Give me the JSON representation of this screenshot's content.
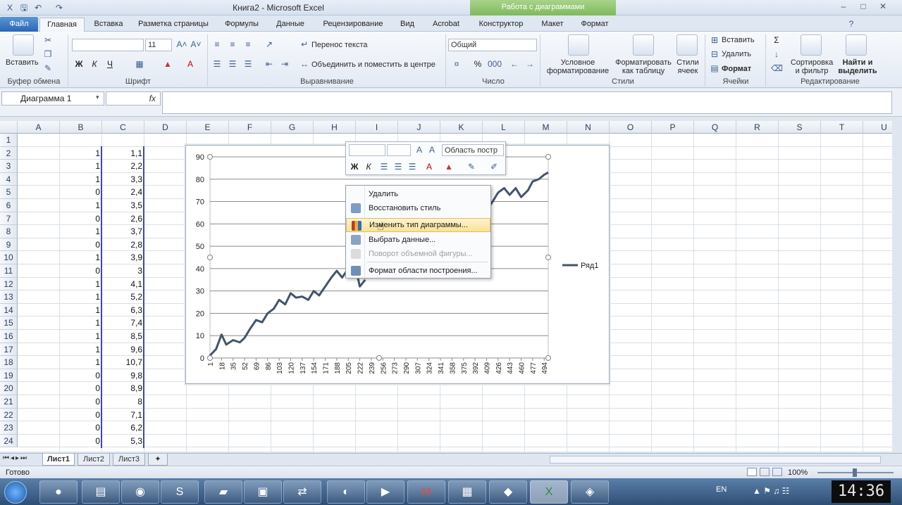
{
  "window": {
    "title": "Книга2 - Microsoft Excel",
    "chart_tools": "Работа с диаграммами"
  },
  "tabs": [
    "Файл",
    "Главная",
    "Вставка",
    "Разметка страницы",
    "Формулы",
    "Данные",
    "Рецензирование",
    "Вид",
    "Acrobat",
    "Конструктор",
    "Макет",
    "Формат"
  ],
  "ribbon": {
    "clipboard": {
      "paste": "Вставить",
      "label": "Буфер обмена"
    },
    "font": {
      "size": "11",
      "label": "Шрифт",
      "bold": "Ж",
      "italic": "К",
      "underline": "Ч"
    },
    "alignment": {
      "wrap": "Перенос текста",
      "merge": "Объединить и поместить в центре",
      "label": "Выравнивание"
    },
    "number": {
      "format": "Общий",
      "percent": "%",
      "label": "Число"
    },
    "styles": {
      "conditional": "Условное форматирование",
      "as_table": "Форматировать как таблицу",
      "cell_styles": "Стили ячеек",
      "label": "Стили"
    },
    "cells": {
      "insert": "Вставить",
      "delete": "Удалить",
      "format": "Формат",
      "label": "Ячейки"
    },
    "editing": {
      "sum": "Σ",
      "sort": "Сортировка и фильтр",
      "find": "Найти и выделить",
      "label": "Редактирование"
    }
  },
  "formula_bar": {
    "name_box": "Диаграмма 1",
    "fx": "fx"
  },
  "columns": [
    "A",
    "B",
    "C",
    "D",
    "E",
    "F",
    "G",
    "H",
    "I",
    "J",
    "K",
    "L",
    "M",
    "N",
    "O",
    "P",
    "Q",
    "R",
    "S",
    "T",
    "U"
  ],
  "rows": [
    "1",
    "2",
    "3",
    "4",
    "5",
    "6",
    "7",
    "8",
    "9",
    "10",
    "11",
    "12",
    "13",
    "14",
    "15",
    "16",
    "17",
    "18",
    "19",
    "20",
    "21",
    "22",
    "23",
    "24"
  ],
  "col_b": [
    "",
    "1",
    "1",
    "1",
    "0",
    "1",
    "0",
    "1",
    "0",
    "1",
    "0",
    "1",
    "1",
    "1",
    "1",
    "1",
    "1",
    "1",
    "0",
    "0",
    "0",
    "0",
    "0",
    "0"
  ],
  "col_c": [
    "",
    "1,1",
    "2,2",
    "3,3",
    "2,4",
    "3,5",
    "2,6",
    "3,7",
    "2,8",
    "3,9",
    "3",
    "4,1",
    "5,2",
    "6,3",
    "7,4",
    "8,5",
    "9,6",
    "10,7",
    "9,8",
    "8,9",
    "8",
    "7,1",
    "6,2",
    "5,3"
  ],
  "mini_toolbar": {
    "element": "Область постр",
    "bold": "Ж",
    "italic": "К"
  },
  "context_menu": {
    "items": [
      {
        "label": "Удалить",
        "enabled": true
      },
      {
        "label": "Восстановить стиль",
        "enabled": true
      },
      {
        "label": "Изменить тип диаграммы...",
        "enabled": true,
        "hover": true
      },
      {
        "label": "Выбрать данные...",
        "enabled": true
      },
      {
        "label": "Поворот объемной фигуры...",
        "enabled": false
      },
      {
        "label": "Формат области построения...",
        "enabled": true
      }
    ]
  },
  "chart_data": {
    "type": "line",
    "y_ticks": [
      "0",
      "10",
      "20",
      "30",
      "40",
      "50",
      "60",
      "70",
      "80",
      "90"
    ],
    "ylim": [
      0,
      90
    ],
    "x_ticks": [
      "1",
      "18",
      "35",
      "52",
      "69",
      "86",
      "103",
      "120",
      "137",
      "154",
      "171",
      "188",
      "205",
      "222",
      "239",
      "256",
      "273",
      "290",
      "307",
      "324",
      "341",
      "358",
      "375",
      "392",
      "409",
      "426",
      "443",
      "460",
      "477",
      "494"
    ],
    "legend": "Ряд1",
    "legend_position": "right",
    "grid": true,
    "series": [
      {
        "name": "Ряд1",
        "color": "#44546a",
        "x": [
          1,
          10,
          18,
          25,
          35,
          45,
          52,
          60,
          69,
          78,
          86,
          95,
          103,
          112,
          120,
          128,
          137,
          146,
          154,
          162,
          171,
          180,
          188,
          196,
          205,
          214,
          222,
          230
        ],
        "values": [
          1.1,
          4,
          10.5,
          6,
          8,
          7,
          9,
          13,
          17,
          16,
          20,
          22,
          26,
          24,
          29,
          27,
          27.5,
          26,
          30,
          28,
          32,
          36,
          39,
          36,
          40,
          43,
          32,
          35
        ],
        "x2": [
          409,
          418,
          426,
          435,
          443,
          452,
          460,
          470,
          477,
          486,
          494,
          500
        ],
        "values2": [
          66,
          70,
          74,
          76,
          73,
          76,
          72,
          75,
          79,
          80,
          82,
          83
        ]
      }
    ]
  },
  "sheets": [
    "Лист1",
    "Лист2",
    "Лист3"
  ],
  "status": {
    "ready": "Готово",
    "zoom": "100%"
  },
  "taskbar": {
    "lang": "EN",
    "clock": "14:36"
  }
}
